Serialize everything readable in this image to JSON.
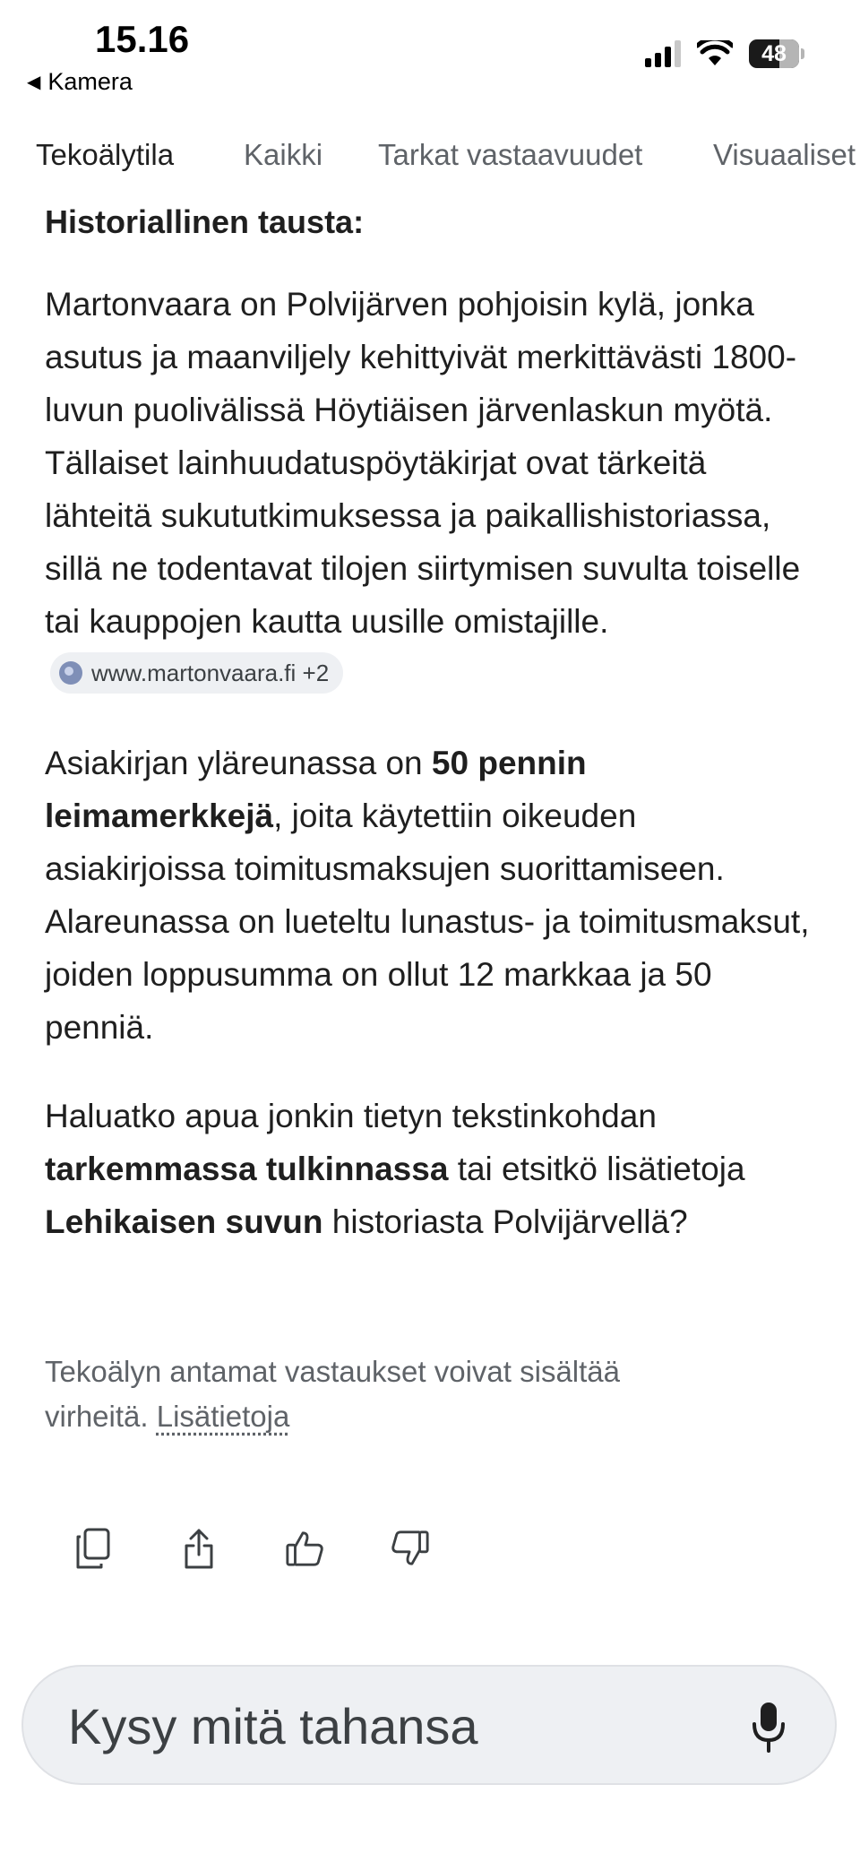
{
  "status": {
    "time": "15.16",
    "back_app": "Kamera",
    "battery": "48"
  },
  "tabs": [
    "Tekoälytila",
    "Kaikki",
    "Tarkat vastaavuudet",
    "Visuaaliset"
  ],
  "content": {
    "heading": "Historiallinen tausta:",
    "p1": "Martonvaara on Polvijärven pohjoisin kylä, jonka asutus ja maanviljely kehittyivät merkittävästi 1800-luvun puolivälissä Höytiäisen järvenlaskun myötä. Tällaiset lainhuudatuspöytäkirjat ovat tärkeitä lähteitä sukututkimuksessa ja paikallishistoriassa, sillä ne todentavat tilojen siirtymisen suvulta toiselle tai kauppojen kautta uusille omistajille.",
    "source_chip": "www.martonvaara.fi +2",
    "p2_a": "Asiakirjan yläreunassa on ",
    "p2_b": "50 pennin leimamerkkejä",
    "p2_c": ", joita käytettiin oikeuden asiakirjoissa toimitusmaksujen suorittamiseen. Alareunassa on lueteltu lunastus- ja toimitusmaksut, joiden loppusumma on ollut 12 markkaa ja 50 penniä.",
    "p3_a": "Haluatko apua jonkin tietyn tekstinkohdan ",
    "p3_b": "tarkemmassa tulkinnassa",
    "p3_c": " tai etsitkö lisätietoja ",
    "p3_d": "Lehikaisen suvun",
    "p3_e": " historiasta Polvijärvellä?"
  },
  "disclaimer": {
    "text": "Tekoälyn antamat vastaukset voivat sisältää virheitä. ",
    "link": "Lisätietoja"
  },
  "actions": [
    "copy-icon",
    "share-icon",
    "thumbs-up-icon",
    "thumbs-down-icon"
  ],
  "ask": {
    "placeholder": "Kysy mitä tahansa"
  }
}
